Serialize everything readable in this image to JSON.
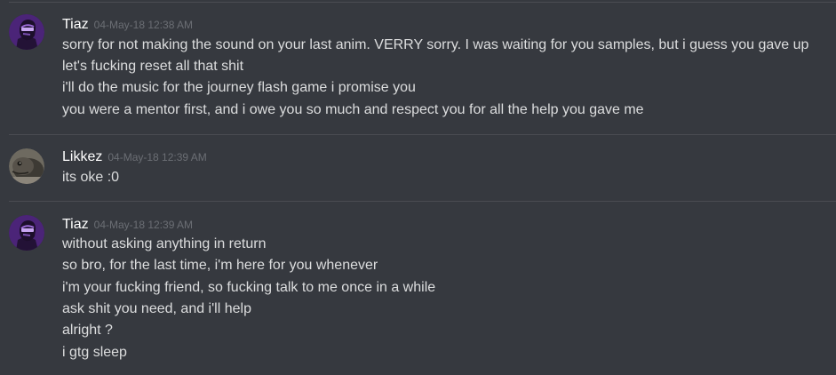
{
  "messages": [
    {
      "author": "Tiaz",
      "timestamp": "04-May-18 12:38 AM",
      "avatar": "tiaz-avatar",
      "lines": [
        "sorry for not making the sound on your last anim. VERRY sorry. I was waiting for you samples, but i guess you gave up",
        "let's fucking reset all that shit",
        "i'll do the music for the journey flash game i promise you",
        "you were a mentor first, and  i owe you so much and respect you for all the help you gave me"
      ]
    },
    {
      "author": "Likkez",
      "timestamp": "04-May-18 12:39 AM",
      "avatar": "likkez-avatar",
      "lines": [
        "its oke :0"
      ]
    },
    {
      "author": "Tiaz",
      "timestamp": "04-May-18 12:39 AM",
      "avatar": "tiaz-avatar",
      "lines": [
        "without asking anything in return",
        "so bro, for the last time, i'm here for you whenever",
        "i'm your fucking friend, so fucking talk to me once in a while",
        "ask shit you need, and i'll help",
        "alright ?",
        "i gtg sleep"
      ]
    }
  ],
  "colors": {
    "background": "#36393f",
    "username": "#ffffff",
    "timestamp": "#6b6e74",
    "text": "#dcddde",
    "divider": "#4a4c52"
  }
}
